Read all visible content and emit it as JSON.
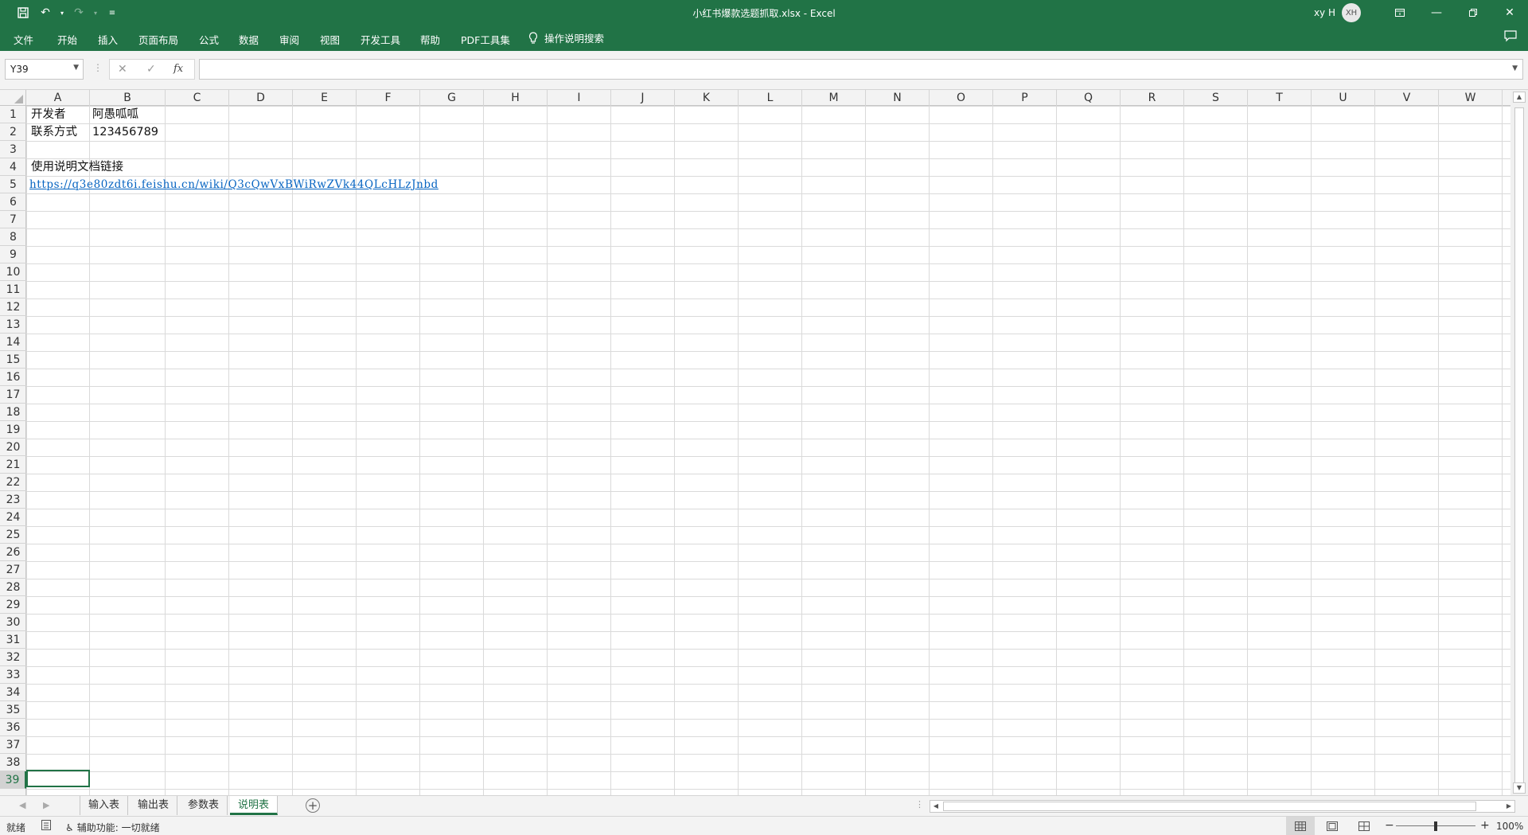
{
  "window": {
    "title": "小红书爆款选题抓取.xlsx  -  Excel",
    "user_name": "xy H",
    "user_initials": "XH"
  },
  "ribbon": {
    "tabs": [
      "文件",
      "开始",
      "插入",
      "页面布局",
      "公式",
      "数据",
      "审阅",
      "视图",
      "开发工具",
      "帮助",
      "PDF工具集"
    ],
    "tell_me": "操作说明搜索"
  },
  "formula_bar": {
    "name_box": "Y39",
    "formula": "",
    "fx_label": "fx"
  },
  "grid": {
    "columns": [
      "A",
      "B",
      "C",
      "D",
      "E",
      "F",
      "G",
      "H",
      "I",
      "J",
      "K",
      "L",
      "M",
      "N",
      "O",
      "P",
      "Q",
      "R",
      "S",
      "T",
      "U",
      "V",
      "W"
    ],
    "rows": [
      "1",
      "2",
      "3",
      "4",
      "5",
      "6",
      "7",
      "8",
      "9",
      "10",
      "11",
      "12",
      "13",
      "14",
      "15",
      "16",
      "17",
      "18",
      "19",
      "20",
      "21",
      "22",
      "23",
      "24",
      "25",
      "26",
      "27",
      "28",
      "29",
      "30",
      "31",
      "32",
      "33",
      "34",
      "35",
      "36",
      "37",
      "38",
      "39"
    ],
    "selected_row": "39",
    "cells": {
      "A1": "开发者",
      "B1": "阿愚呱呱",
      "A2": "联系方式",
      "B2": "123456789",
      "A4": "使用说明文档链接",
      "A5": "https://q3e80zdt6i.feishu.cn/wiki/Q3cQwVxBWiRwZVk44QLcHLzJnbd"
    }
  },
  "sheets": {
    "tabs": [
      "输入表",
      "输出表",
      "参数表",
      "说明表"
    ],
    "active": "说明表"
  },
  "status": {
    "ready": "就绪",
    "accessibility": "辅助功能: 一切就绪",
    "zoom": "100%",
    "zoom_level_percent": 100
  }
}
